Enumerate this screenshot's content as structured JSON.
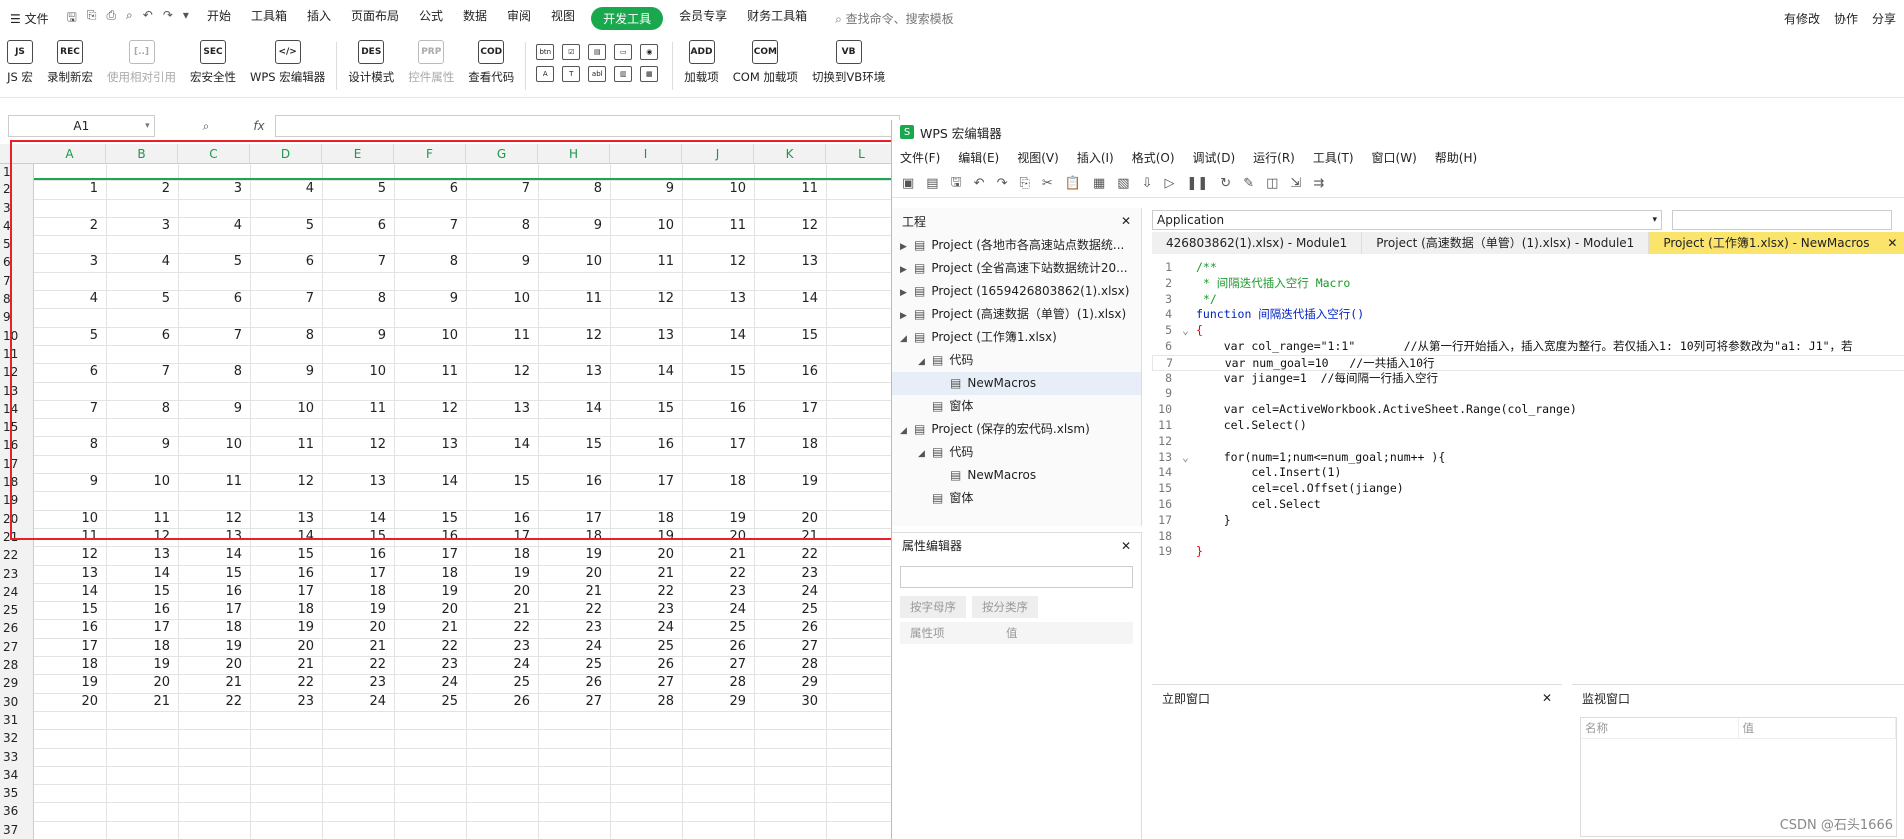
{
  "menubar": {
    "file": "文件",
    "tabs": [
      "开始",
      "工具箱",
      "插入",
      "页面布局",
      "公式",
      "数据",
      "审阅",
      "视图",
      "开发工具",
      "会员专享",
      "财务工具箱"
    ],
    "active_tab": "开发工具",
    "search": "查找命令、搜索模板",
    "right": [
      "有修改",
      "协作",
      "分享"
    ]
  },
  "ribbon": {
    "buttons": [
      {
        "label": "JS 宏",
        "icon": "JS"
      },
      {
        "label": "录制新宏",
        "icon": "REC"
      },
      {
        "label": "使用相对引用",
        "icon": "[..]"
      },
      {
        "label": "宏安全性",
        "icon": "SEC"
      },
      {
        "label": "WPS 宏编辑器",
        "icon": "</>"
      }
    ],
    "buttons2": [
      {
        "label": "设计模式",
        "icon": "DES"
      },
      {
        "label": "控件属性",
        "icon": "PRP"
      },
      {
        "label": "查看代码",
        "icon": "COD"
      }
    ],
    "controls": [
      "btn",
      "☑",
      "▤",
      "▭",
      "◉",
      "A",
      "T",
      "abl",
      "▥",
      "▦"
    ],
    "buttons3": [
      {
        "label": "加载项",
        "icon": "ADD"
      },
      {
        "label": "COM 加载项",
        "icon": "COM"
      },
      {
        "label": "切换到VB环境",
        "icon": "VB"
      }
    ]
  },
  "formula": {
    "namebox": "A1",
    "fx": "fx"
  },
  "columns": [
    "A",
    "B",
    "C",
    "D",
    "E",
    "F",
    "G",
    "H",
    "I",
    "J",
    "K",
    "L"
  ],
  "sparse_rows": [
    {
      "r": 2,
      "v": [
        1,
        2,
        3,
        4,
        5,
        6,
        7,
        8,
        9,
        10,
        11
      ]
    },
    {
      "r": 4,
      "v": [
        2,
        3,
        4,
        5,
        6,
        7,
        8,
        9,
        10,
        11,
        12
      ]
    },
    {
      "r": 6,
      "v": [
        3,
        4,
        5,
        6,
        7,
        8,
        9,
        10,
        11,
        12,
        13
      ]
    },
    {
      "r": 8,
      "v": [
        4,
        5,
        6,
        7,
        8,
        9,
        10,
        11,
        12,
        13,
        14
      ]
    },
    {
      "r": 10,
      "v": [
        5,
        6,
        7,
        8,
        9,
        10,
        11,
        12,
        13,
        14,
        15
      ]
    },
    {
      "r": 12,
      "v": [
        6,
        7,
        8,
        9,
        10,
        11,
        12,
        13,
        14,
        15,
        16
      ]
    },
    {
      "r": 14,
      "v": [
        7,
        8,
        9,
        10,
        11,
        12,
        13,
        14,
        15,
        16,
        17
      ]
    },
    {
      "r": 16,
      "v": [
        8,
        9,
        10,
        11,
        12,
        13,
        14,
        15,
        16,
        17,
        18
      ]
    },
    {
      "r": 18,
      "v": [
        9,
        10,
        11,
        12,
        13,
        14,
        15,
        16,
        17,
        18,
        19
      ]
    },
    {
      "r": 20,
      "v": [
        10,
        11,
        12,
        13,
        14,
        15,
        16,
        17,
        18,
        19,
        20
      ]
    }
  ],
  "dense_rows": [
    {
      "r": 21,
      "v": [
        11,
        12,
        13,
        14,
        15,
        16,
        17,
        18,
        19,
        20,
        21
      ]
    },
    {
      "r": 22,
      "v": [
        12,
        13,
        14,
        15,
        16,
        17,
        18,
        19,
        20,
        21,
        22
      ]
    },
    {
      "r": 23,
      "v": [
        13,
        14,
        15,
        16,
        17,
        18,
        19,
        20,
        21,
        22,
        23
      ]
    },
    {
      "r": 24,
      "v": [
        14,
        15,
        16,
        17,
        18,
        19,
        20,
        21,
        22,
        23,
        24
      ]
    },
    {
      "r": 25,
      "v": [
        15,
        16,
        17,
        18,
        19,
        20,
        21,
        22,
        23,
        24,
        25
      ]
    },
    {
      "r": 26,
      "v": [
        16,
        17,
        18,
        19,
        20,
        21,
        22,
        23,
        24,
        25,
        26
      ]
    },
    {
      "r": 27,
      "v": [
        17,
        18,
        19,
        20,
        21,
        22,
        23,
        24,
        25,
        26,
        27
      ]
    },
    {
      "r": 28,
      "v": [
        18,
        19,
        20,
        21,
        22,
        23,
        24,
        25,
        26,
        27,
        28
      ]
    },
    {
      "r": 29,
      "v": [
        19,
        20,
        21,
        22,
        23,
        24,
        25,
        26,
        27,
        28,
        29
      ]
    },
    {
      "r": 30,
      "v": [
        20,
        21,
        22,
        23,
        24,
        25,
        26,
        27,
        28,
        29,
        30
      ]
    }
  ],
  "empty_rows": [
    31,
    32,
    33,
    34,
    35,
    36,
    37
  ],
  "editor": {
    "title": "WPS 宏编辑器",
    "menu": [
      "文件(F)",
      "编辑(E)",
      "视图(V)",
      "插入(I)",
      "格式(O)",
      "调试(D)",
      "运行(R)",
      "工具(T)",
      "窗口(W)",
      "帮助(H)"
    ],
    "project_title": "工程",
    "tree": [
      {
        "label": "Project (各地市各高速站点数据统...",
        "lvl": 0,
        "arrow": "▶"
      },
      {
        "label": "Project (全省高速下站数据统计20...",
        "lvl": 0,
        "arrow": "▶"
      },
      {
        "label": "Project (1659426803862(1).xlsx)",
        "lvl": 0,
        "arrow": "▶"
      },
      {
        "label": "Project (高速数据（单管）(1).xlsx)",
        "lvl": 0,
        "arrow": "▶"
      },
      {
        "label": "Project (工作簿1.xlsx)",
        "lvl": 0,
        "arrow": "◢"
      },
      {
        "label": "代码",
        "lvl": 1,
        "arrow": "◢"
      },
      {
        "label": "NewMacros",
        "lvl": 2,
        "arrow": "",
        "sel": true
      },
      {
        "label": "窗体",
        "lvl": 1,
        "arrow": ""
      },
      {
        "label": "Project (保存的宏代码.xlsm)",
        "lvl": 0,
        "arrow": "◢"
      },
      {
        "label": "代码",
        "lvl": 1,
        "arrow": "◢"
      },
      {
        "label": "NewMacros",
        "lvl": 2,
        "arrow": ""
      },
      {
        "label": "窗体",
        "lvl": 1,
        "arrow": ""
      }
    ],
    "prop_title": "属性编辑器",
    "prop_tabs": [
      "按字母序",
      "按分类序"
    ],
    "prop_cols": [
      "属性项",
      "值"
    ],
    "combo": "Application",
    "tabs": [
      "426803862(1).xlsx) - Module1",
      "Project (高速数据（单管）(1).xlsx) - Module1",
      "Project (工作簿1.xlsx) - NewMacros"
    ],
    "immediate": "立即窗口",
    "watch": "监视窗口",
    "watch_cols": [
      "名称",
      "值"
    ]
  },
  "code": [
    {
      "t": "/**",
      "c": "c-cm"
    },
    {
      "t": " * 间隔迭代插入空行 Macro",
      "c": "c-cm"
    },
    {
      "t": " */",
      "c": "c-cm"
    },
    {
      "t": "function 间隔迭代插入空行()",
      "c": "c-kw"
    },
    {
      "t": "{",
      "c": "c-red"
    },
    {
      "t": "    var col_range=\"1:1\"       //从第一行开始插入，插入宽度为整行。若仅插入1: 10列可将参数改为\"a1: J1\"，若",
      "c": "txt"
    },
    {
      "t": "    var num_goal=10   //一共插入10行",
      "c": "txt"
    },
    {
      "t": "    var jiange=1  //每间隔一行插入空行",
      "c": "txt"
    },
    {
      "t": "",
      "c": "txt"
    },
    {
      "t": "    var cel=ActiveWorkbook.ActiveSheet.Range(col_range)",
      "c": "txt"
    },
    {
      "t": "    cel.Select()",
      "c": "txt"
    },
    {
      "t": "",
      "c": "txt"
    },
    {
      "t": "    for(num=1;num<=num_goal;num++ ){",
      "c": "txt"
    },
    {
      "t": "        cel.Insert(1)",
      "c": "txt"
    },
    {
      "t": "        cel=cel.Offset(jiange)",
      "c": "txt"
    },
    {
      "t": "        cel.Select",
      "c": "txt"
    },
    {
      "t": "    }",
      "c": "txt"
    },
    {
      "t": "",
      "c": "txt"
    },
    {
      "t": "}",
      "c": "c-red"
    }
  ],
  "watermark": "CSDN @石头1666"
}
